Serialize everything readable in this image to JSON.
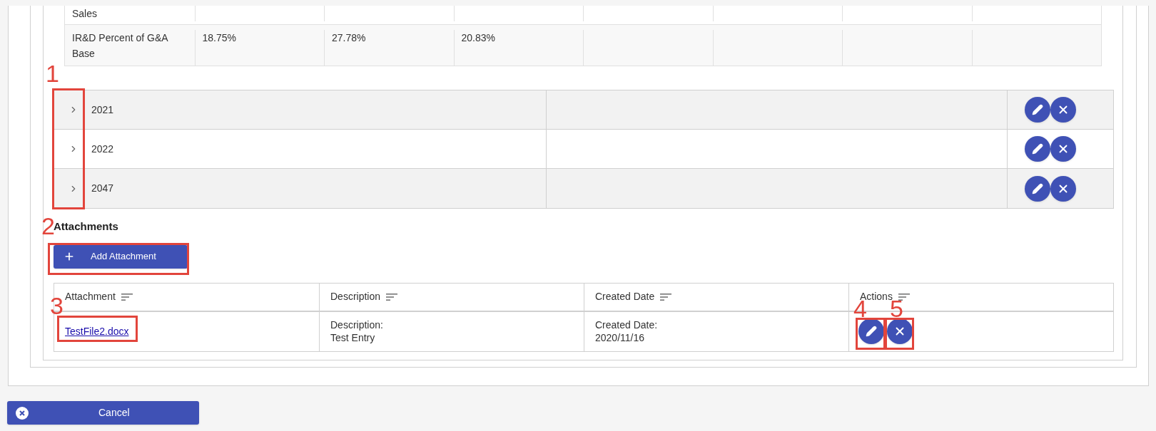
{
  "cost_table": {
    "rows": [
      {
        "label": "Sales",
        "values": []
      },
      {
        "label": "IR&D Percent of G&A Base",
        "values": [
          "18.75%",
          "27.78%",
          "20.83%"
        ]
      }
    ]
  },
  "years": [
    {
      "label": "2021",
      "expanded": false
    },
    {
      "label": "2022",
      "expanded": false
    },
    {
      "label": "2047",
      "expanded": false
    }
  ],
  "attachments": {
    "heading": "Attachments",
    "add_button": "Add Attachment",
    "columns": [
      "Attachment",
      "Description",
      "Created Date",
      "Actions"
    ],
    "rows": [
      {
        "file": "TestFile2.docx",
        "description": [
          "Description:",
          "Test Entry"
        ],
        "created": [
          "Created Date:",
          "2020/11/16"
        ]
      }
    ]
  },
  "cancel_button": "Cancel",
  "callouts": [
    "1",
    "2",
    "3",
    "4",
    "5"
  ]
}
